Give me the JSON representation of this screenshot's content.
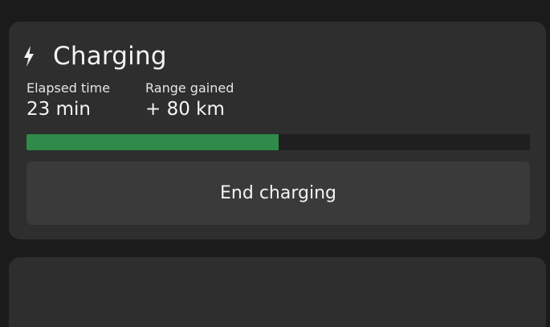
{
  "charging": {
    "title": "Charging",
    "icon": "lightning-bolt-icon",
    "elapsed_label": "Elapsed time",
    "elapsed_value": "23 min",
    "range_label": "Range gained",
    "range_value": "+ 80 km",
    "progress_fraction": 0.5,
    "progress_color": "#2e8b4a",
    "end_button_label": "End charging"
  }
}
